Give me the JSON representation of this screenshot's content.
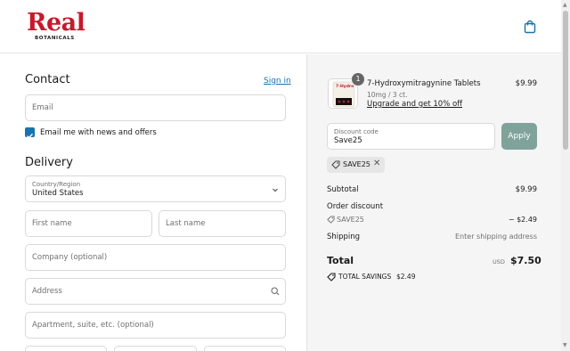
{
  "header": {
    "brand": "Real",
    "brand_sub": "BOTANICALS",
    "cart_icon": "shopping-bag-icon"
  },
  "contact": {
    "title": "Contact",
    "sign_in": "Sign in",
    "email_placeholder": "Email",
    "newsletter_label": "Email me with news and offers",
    "newsletter_checked": true
  },
  "delivery": {
    "title": "Delivery",
    "country_label": "Country/Region",
    "country_value": "United States",
    "first_name": "First name",
    "last_name": "Last name",
    "company": "Company (optional)",
    "address": "Address",
    "apartment": "Apartment, suite, etc. (optional)"
  },
  "summary": {
    "product": {
      "name": "7-Hydroxymitragynine Tablets",
      "variant": "10mg / 3 ct.",
      "upsell": "Upgrade and get 10% off",
      "price": "$9.99",
      "quantity": "1",
      "thumb_text": "7-Hydro"
    },
    "discount_label": "Discount code",
    "discount_value": "Save25",
    "apply": "Apply",
    "applied_code": "SAVE25",
    "subtotal_label": "Subtotal",
    "subtotal_value": "$9.99",
    "order_discount_label": "Order discount",
    "order_discount_code": "SAVE25",
    "order_discount_value": "− $2.49",
    "shipping_label": "Shipping",
    "shipping_value": "Enter shipping address",
    "total_label": "Total",
    "currency": "USD",
    "total_value": "$7.50",
    "savings_label": "TOTAL SAVINGS",
    "savings_value": "$2.49"
  },
  "colors": {
    "brand_red": "#c8192c",
    "link_blue": "#1773b0",
    "apply_button": "#7fa39a"
  }
}
